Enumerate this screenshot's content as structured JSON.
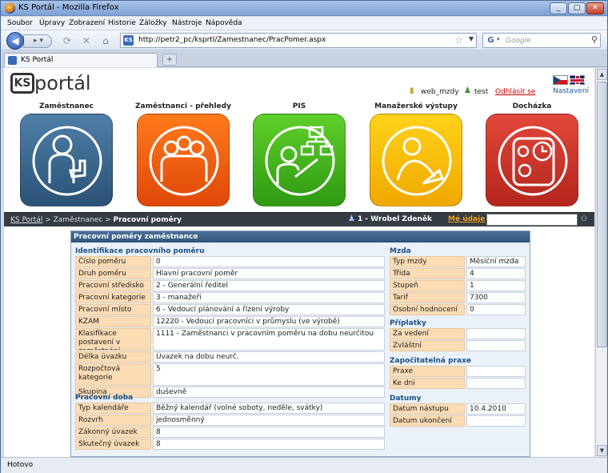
{
  "browser": {
    "title": "KS Portál - Mozilla Firefox",
    "menu": [
      "Soubor",
      "Úpravy",
      "Zobrazení",
      "Historie",
      "Záložky",
      "Nástroje",
      "Nápověda"
    ],
    "url": "http://petr2_pc/ksprtl/Zamestnanec/PracPomer.aspx",
    "search_placeholder": "Google",
    "tab_title": "KS Portál",
    "status": "Hotovo",
    "window_buttons": [
      "_",
      "□",
      "✕"
    ]
  },
  "header": {
    "logo_mark": "KS",
    "logo_text": "portál",
    "db_user": "web_mzdy",
    "login_user": "test",
    "logout": "Odhlásit se",
    "settings": "Nastavení"
  },
  "modules": [
    {
      "label": "Zaměstnanec",
      "color_top": "#4f7fa8",
      "color_bottom": "#2a5275"
    },
    {
      "label": "Zaměstnanci - přehledy",
      "color_top": "#ff7a1a",
      "color_bottom": "#e0480a"
    },
    {
      "label": "PIS",
      "color_top": "#5fcf2a",
      "color_bottom": "#2f9a12"
    },
    {
      "label": "Manažerské výstupy",
      "color_top": "#ffd21a",
      "color_bottom": "#f0a800"
    },
    {
      "label": "Docházka",
      "color_top": "#e2473a",
      "color_bottom": "#b3261c"
    }
  ],
  "breadcrumb": {
    "root": "KS Portál",
    "sep1": " > ",
    "mid": "Zaměstnanec",
    "sep2": " > ",
    "current": "Pracovní poměry",
    "user": "1 - Wrobel Zdeněk",
    "my_data": "Mé údaje"
  },
  "panel": {
    "title": "Pracovní poměry zaměstnance",
    "identification": {
      "heading": "Identifikace pracovního poměru",
      "rows": [
        {
          "label": "Číslo poměru",
          "value": "0"
        },
        {
          "label": "Druh poměru",
          "value": "Hlavní pracovní poměr"
        },
        {
          "label": "Pracovní středisko",
          "value": "2 - Generální ředitel"
        },
        {
          "label": "Pracovní kategorie",
          "value": "3 - manažeři"
        },
        {
          "label": "Pracovní místo",
          "value": "6 - Vedoucí plánování a řízení výroby"
        },
        {
          "label": "KZAM",
          "value": "12220 - Vedoucí pracovníci v průmyslu (ve výrobě)"
        },
        {
          "label": "Klasifikace postavení v zaměstnání",
          "value": "1111 - Zaměstnanci v pracovním poměru na dobu neurčitou"
        },
        {
          "label": "Délka úvazku",
          "value": "Úvazek na dobu neurč."
        },
        {
          "label": "Rozpočtová kategorie",
          "value": "5"
        },
        {
          "label": "Skupina pracujících",
          "value": "duševně"
        }
      ]
    },
    "worktime": {
      "heading": "Pracovní doba",
      "rows": [
        {
          "label": "Typ kalendáře",
          "value": "Běžný kalendář (volné soboty, neděle, svátky)"
        },
        {
          "label": "Rozvrh",
          "value": "jednosměnný"
        },
        {
          "label": "Zákonný úvazek",
          "value": "8"
        },
        {
          "label": "Skutečný úvazek",
          "value": "8"
        }
      ]
    },
    "wage": {
      "heading": "Mzda",
      "rows": [
        {
          "label": "Typ mzdy",
          "value": "Měsíční mzda"
        },
        {
          "label": "Třída",
          "value": "4"
        },
        {
          "label": "Stupeň",
          "value": "1"
        },
        {
          "label": "Tarif",
          "value": "7300"
        },
        {
          "label": "Osobní hodnocení",
          "value": "0"
        }
      ]
    },
    "bonus": {
      "heading": "Příplatky",
      "rows": [
        {
          "label": "Za vedení",
          "value": ""
        },
        {
          "label": "Zvláštní",
          "value": ""
        }
      ]
    },
    "practice": {
      "heading": "Započitatelná praxe",
      "rows": [
        {
          "label": "Praxe",
          "value": ""
        },
        {
          "label": "Ke dni",
          "value": ""
        }
      ]
    },
    "dates": {
      "heading": "Datumy",
      "rows": [
        {
          "label": "Datum nástupu",
          "value": "10.4.2010"
        },
        {
          "label": "Datum ukončení",
          "value": ""
        }
      ]
    }
  }
}
